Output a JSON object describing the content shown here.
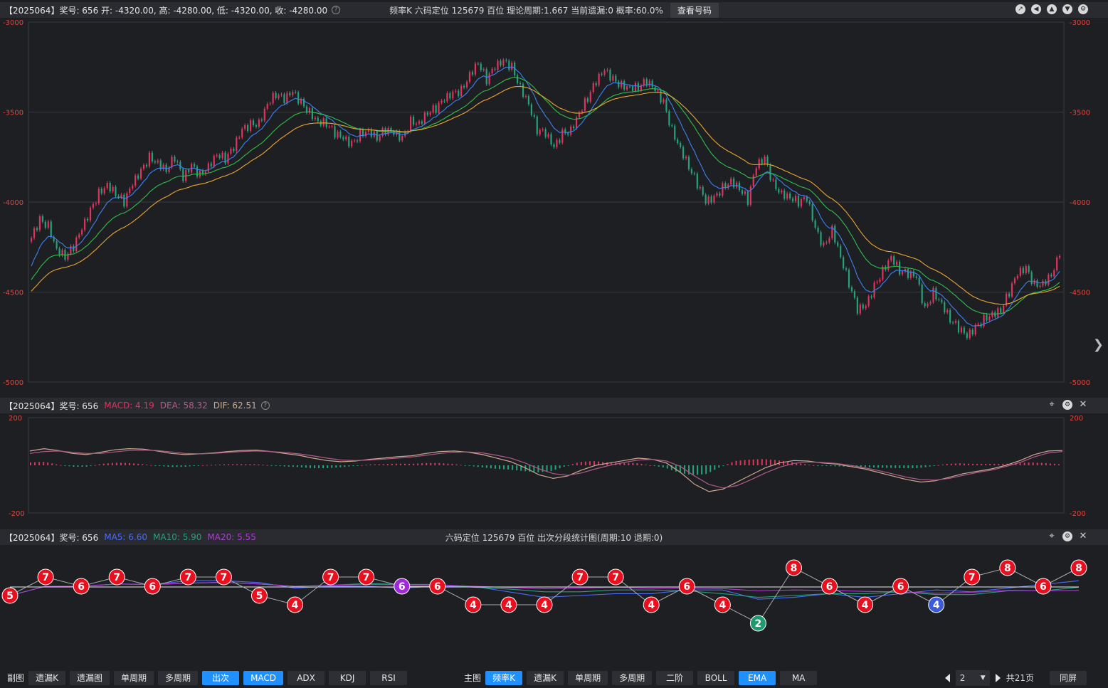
{
  "main_bar": {
    "left": "【2025064】奖号: 656   开: -4320.00, 高: -4280.00, 低: -4320.00, 收: -4280.00",
    "center": "频率K  六码定位  125679   百位  理论周期:1.667   当前遗漏:0   概率:60.0%",
    "query_button": "查看号码"
  },
  "macd_bar": {
    "prefix": "【2025064】奖号: 656",
    "macd": "MACD: 4.19",
    "dea": "DEA: 58.32",
    "dif": "DIF: 62.51"
  },
  "seg_bar": {
    "prefix": "【2025064】奖号: 656",
    "ma5": "MA5: 6.60",
    "ma10": "MA10: 5.90",
    "ma20": "MA20: 5.55",
    "center": "六码定位  125679     百位  出次分段统计图(周期:10   退期:0)"
  },
  "colors": {
    "up": "#e0335e",
    "down": "#26a17a",
    "ema_fast": "#3b82f6",
    "ema_mid": "#2fbf4a",
    "ema_slow": "#e8a630",
    "grid": "#3a3b40",
    "accent": "#1e90ff"
  },
  "icons": [
    "compass-icon",
    "back-icon",
    "up-icon",
    "down-icon",
    "gear-icon"
  ],
  "chart_data": [
    {
      "type": "candlestick",
      "ylim": [
        -5000,
        -3000
      ],
      "yticks": [
        "-3000",
        "-3500",
        "-4000",
        "-4500",
        "-5000"
      ],
      "series": [
        {
          "values": [
            -4200,
            -4100,
            -4130,
            -4260,
            -4300,
            -4250,
            -4150,
            -4050,
            -3950,
            -3900,
            -3950,
            -4000,
            -3900,
            -3830,
            -3750,
            -3780,
            -3820,
            -3750,
            -3870,
            -3800,
            -3850,
            -3800,
            -3730,
            -3760,
            -3700,
            -3600,
            -3570,
            -3560,
            -3450,
            -3400,
            -3430,
            -3390,
            -3450,
            -3500,
            -3550,
            -3560,
            -3620,
            -3650,
            -3680,
            -3620,
            -3600,
            -3640,
            -3600,
            -3620,
            -3650,
            -3550,
            -3560,
            -3500,
            -3480,
            -3430,
            -3400,
            -3380,
            -3290,
            -3220,
            -3320,
            -3250,
            -3220,
            -3250,
            -3360,
            -3450,
            -3600,
            -3620,
            -3700,
            -3620,
            -3600,
            -3500,
            -3420,
            -3330,
            -3270,
            -3320,
            -3350,
            -3360,
            -3360,
            -3330,
            -3380,
            -3450,
            -3600,
            -3700,
            -3800,
            -3900,
            -4000,
            -3980,
            -3920,
            -3880,
            -3920,
            -3990,
            -3800,
            -3760,
            -3900,
            -3950,
            -3970,
            -4000,
            -3980,
            -4150,
            -4250,
            -4150,
            -4300,
            -4450,
            -4600,
            -4580,
            -4470,
            -4380,
            -4300,
            -4380,
            -4400,
            -4420,
            -4600,
            -4500,
            -4560,
            -4650,
            -4700,
            -4750,
            -4700,
            -4650,
            -4620,
            -4600,
            -4500,
            -4400,
            -4370,
            -4460,
            -4450,
            -4400,
            -4300
          ]
        }
      ]
    },
    {
      "type": "line",
      "ylim": [
        -200,
        200
      ],
      "yticks": [
        "200",
        "-200"
      ],
      "series": [
        {
          "name": "DIF",
          "values": [
            60,
            70,
            62,
            50,
            45,
            55,
            65,
            70,
            68,
            60,
            50,
            45,
            48,
            52,
            58,
            62,
            64,
            58,
            50,
            42,
            30,
            20,
            15,
            18,
            25,
            30,
            36,
            40,
            50,
            58,
            60,
            55,
            45,
            30,
            15,
            -10,
            -40,
            -55,
            -45,
            -20,
            0,
            10,
            20,
            30,
            25,
            10,
            -30,
            -80,
            -110,
            -100,
            -70,
            -40,
            -10,
            10,
            20,
            18,
            10,
            5,
            -5,
            -15,
            -30,
            -45,
            -60,
            -70,
            -65,
            -50,
            -35,
            -25,
            -15,
            0,
            20,
            45,
            60,
            62
          ]
        },
        {
          "name": "DEA",
          "values": [
            50,
            58,
            60,
            55,
            50,
            50,
            56,
            62,
            64,
            62,
            56,
            50,
            48,
            50,
            54,
            58,
            60,
            58,
            54,
            48,
            40,
            30,
            22,
            20,
            22,
            26,
            30,
            35,
            42,
            50,
            55,
            56,
            52,
            42,
            30,
            10,
            -15,
            -35,
            -42,
            -32,
            -15,
            0,
            12,
            22,
            25,
            18,
            -5,
            -45,
            -80,
            -95,
            -85,
            -60,
            -32,
            -8,
            8,
            14,
            12,
            8,
            0,
            -10,
            -22,
            -36,
            -50,
            -60,
            -62,
            -55,
            -42,
            -30,
            -20,
            -5,
            12,
            35,
            52,
            58
          ]
        }
      ]
    },
    {
      "type": "line",
      "series": [
        {
          "name": "出次",
          "values": [
            5,
            7,
            6,
            7,
            6,
            7,
            7,
            5,
            4,
            7,
            7,
            6,
            6,
            4,
            4,
            4,
            7,
            7,
            4,
            6,
            4,
            2,
            8,
            6,
            4,
            6,
            4,
            7,
            8,
            6,
            8
          ]
        }
      ]
    }
  ],
  "toolbar": {
    "sub_label": "副图",
    "sub_buttons": [
      "遗漏K",
      "遗漏图",
      "单周期",
      "多周期",
      "出次",
      "MACD",
      "ADX",
      "KDJ",
      "RSI"
    ],
    "main_label": "主图",
    "main_buttons": [
      "频率K",
      "遗漏K",
      "单周期",
      "多周期",
      "二阶",
      "BOLL",
      "EMA",
      "MA"
    ],
    "page_value": "2",
    "total_pages": "共21页",
    "sync_button": "同屏"
  }
}
